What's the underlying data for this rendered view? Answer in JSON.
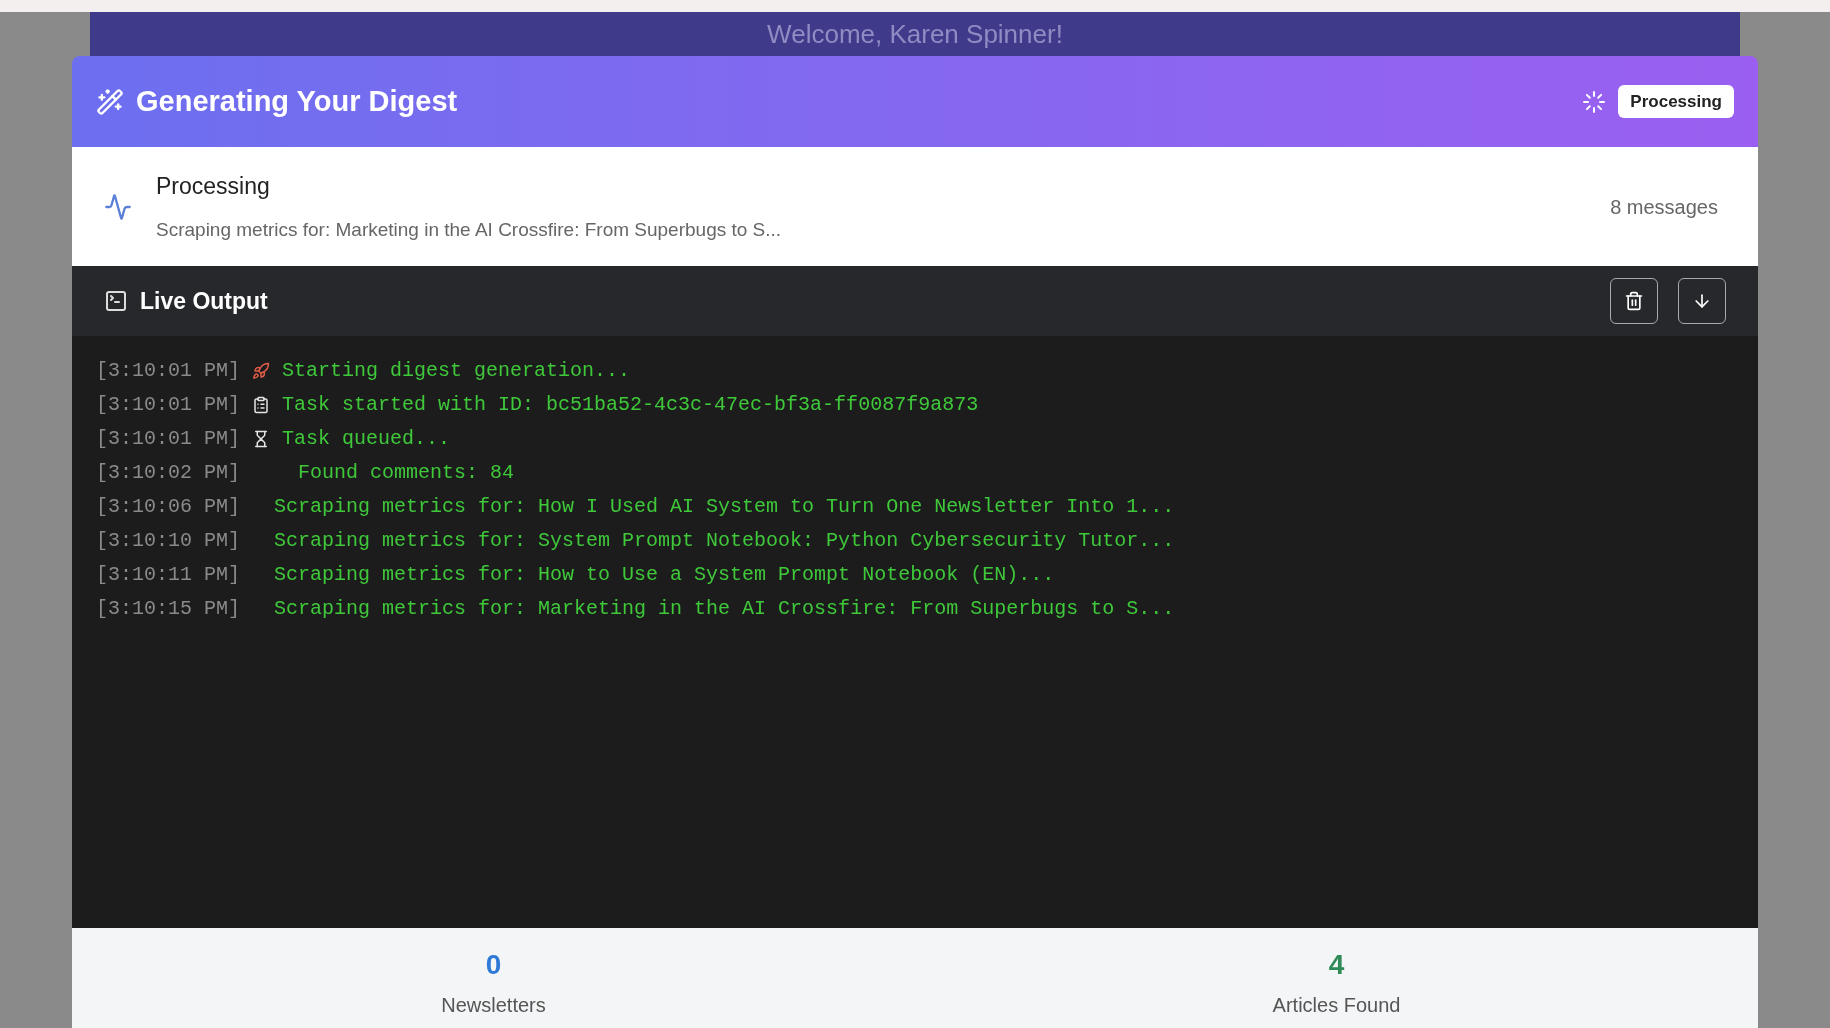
{
  "banner": {
    "title": "Welcome, Karen Spinner!"
  },
  "digest": {
    "title": "Generating Your Digest",
    "status_badge": "Processing"
  },
  "status": {
    "title": "Processing",
    "message": "Scraping metrics for: Marketing in the AI Crossfire: From Superbugs to S...",
    "count": "8 messages"
  },
  "live_output": {
    "title": "Live Output",
    "lines": [
      {
        "time": "[3:10:01 PM]",
        "kind": "rocket",
        "text": "Starting digest generation..."
      },
      {
        "time": "[3:10:01 PM]",
        "kind": "clipboard",
        "text": "Task started with ID: bc51ba52-4c3c-47ec-bf3a-ff0087f9a873"
      },
      {
        "time": "[3:10:01 PM]",
        "kind": "hourglass",
        "text": "Task queued..."
      },
      {
        "time": "[3:10:02 PM]",
        "kind": "indented",
        "text": "Found comments: 84"
      },
      {
        "time": "[3:10:06 PM]",
        "kind": "plain",
        "text": "Scraping metrics for: How I Used AI System to Turn One Newsletter Into 1..."
      },
      {
        "time": "[3:10:10 PM]",
        "kind": "plain",
        "text": "Scraping metrics for: System Prompt Notebook: Python Cybersecurity Tutor..."
      },
      {
        "time": "[3:10:11 PM]",
        "kind": "plain",
        "text": "Scraping metrics for: How to Use a System Prompt Notebook (EN)..."
      },
      {
        "time": "[3:10:15 PM]",
        "kind": "plain",
        "text": "Scraping metrics for: Marketing in the AI Crossfire: From Superbugs to S..."
      }
    ]
  },
  "stats": [
    {
      "value": "0",
      "label": "Newsletters",
      "color": "#2f7ad6"
    },
    {
      "value": "4",
      "label": "Articles Found",
      "color": "#2e8b57"
    }
  ]
}
